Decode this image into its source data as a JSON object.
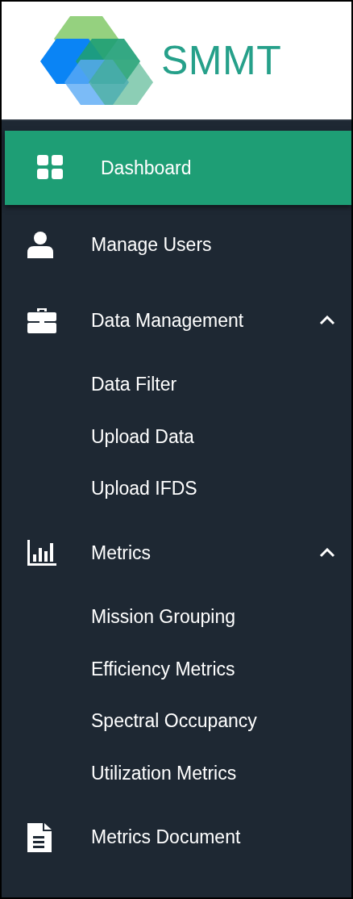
{
  "brand": {
    "name": "SMMT"
  },
  "menu": [
    {
      "label": "Dashboard",
      "selected": true
    },
    {
      "label": "Manage Users",
      "selected": false
    },
    {
      "label": "Data Management",
      "selected": false,
      "expanded": true,
      "children": [
        {
          "label": "Data Filter",
          "selected": false
        },
        {
          "label": "Upload Data",
          "selected": false
        },
        {
          "label": "Upload IFDS",
          "selected": false
        }
      ]
    },
    {
      "label": "Metrics",
      "selected": false,
      "expanded": true,
      "children": [
        {
          "label": "Mission Grouping",
          "selected": false
        },
        {
          "label": "Efficiency Metrics",
          "selected": false
        },
        {
          "label": "Spectral Occupancy",
          "selected": false
        },
        {
          "label": "Utilization Metrics",
          "selected": false
        }
      ]
    },
    {
      "label": "Metrics Document",
      "selected": false
    }
  ]
}
